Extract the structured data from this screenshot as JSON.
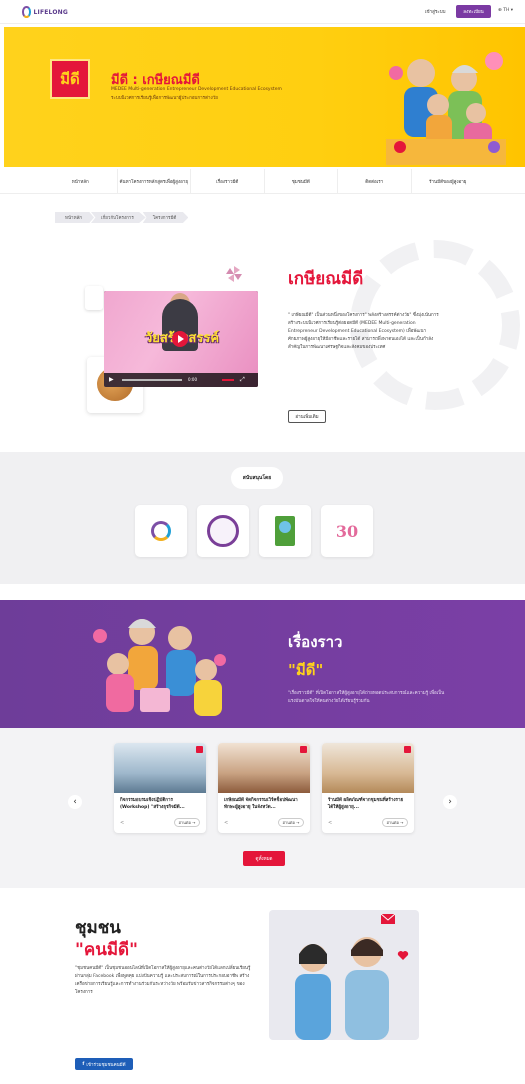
{
  "header": {
    "logo_text": "LIFELONG",
    "login_label": "เข้าสู่ระบบ",
    "register_label": "ลงทะเบียน",
    "lang_label": "TH"
  },
  "hero": {
    "logo_text": "มีดี",
    "title": "มีดี : เกษียณมีดี",
    "subtitle1": "MEDEE Multi-generation Entrepreneur Development Educational Ecosystem",
    "subtitle2": "ระบบนิเวศการเรียนรู้เพื่อการพัฒนาผู้ประกอบการต่างวัย",
    "colors": {
      "bg": "#ffd21c",
      "accent": "#e4163a"
    }
  },
  "nav": {
    "items": [
      "หน้าหลัก",
      "ค้นหาโครงการหลักสูตรเพื่อผู้สูงอายุ",
      "เรื่องราวมีดี",
      "ชุมชนมีดี",
      "ติดต่อเรา",
      "ร้านมีดีของผู้สูงอายุ"
    ]
  },
  "breadcrumb": [
    "หน้าหลัก",
    "เกี่ยวกับโครงการ",
    "โครงการมีดี"
  ],
  "about": {
    "title": "เกษียณมีดี",
    "video_caption": "วัยสร้างสรรค์",
    "video_time": "0:00",
    "text": "\" เกษียณมีดี\" เป็นส่วนหนึ่งของโครงการ\" พลังสร้างสรรค์ต่างวัย\" ซึ่งมุ่งเน้นการสร้างระบบนิเวศการเรียนรู้ต่อยอดมีดี (MEDEE Multi-generation Entrepreneur Development Educational Ecosystem) เพื่อพัฒนาศักยภาพผู้สูงอายุให้มีอาชีพและรายได้ สามารถพึ่งพาตนเองได้ และเป็นกำลังสำคัญในการพัฒนาเศรษฐกิจและสังคมของประเทศ",
    "button_label": "อ่านเพิ่มเติม"
  },
  "supporters": {
    "label": "สนับสนุนโดย",
    "logos": [
      "lifelong-logo",
      "university-seal",
      "green-badge",
      "thirty-years-logo"
    ]
  },
  "stories": {
    "title_line1": "เรื่องราว",
    "title_line2": "\"มีดี\"",
    "text": "\"เรื่องราวมีดี\" ที่เปิดโอกาสให้ผู้สูงอายุได้ถ่ายทอดประสบการณ์และความรู้ เพื่อเป็นแรงบันดาลใจให้คนต่างวัยได้เรียนรู้ร่วมกัน",
    "cards": [
      {
        "title": "กิจกรรมอบรมเชิงปฏิบัติการ (Workshop) \"สร้างธุรกิจมีดี...",
        "more": "อ่านต่อ"
      },
      {
        "title": "เกษียณมีดี จัดกิจกรรมเวิร์คช็อปพัฒนาทักษะผู้สูงอายุ ในจังหวัด...",
        "more": "อ่านต่อ"
      },
      {
        "title": "ร้านมีดี ผลิตภัณฑ์จากชุมชนที่สร้างรายได้ให้ผู้สูงอายุ...",
        "more": "อ่านต่อ"
      }
    ],
    "view_all_label": "ดูทั้งหมด"
  },
  "community": {
    "title_line1": "ชุมชน",
    "title_line2": "\"คนมีดี\"",
    "text": "\"ชุมชนคนมีดี\" เป็นชุมชนออนไลน์ที่เปิดโอกาสให้ผู้สูงอายุและคนต่างวัยได้แลกเปลี่ยนเรียนรู้ ผ่านกลุ่ม Facebook เพื่อพูดคุย แบ่งปันความรู้ และประสบการณ์ในการประกอบอาชีพ สร้างเครือข่ายการเรียนรู้และการทำงานร่วมกันระหว่างวัย พร้อมรับข่าวสารกิจกรรมต่างๆ ของโครงการ",
    "button_label": "เข้าร่วมชุมชนคนมีดี"
  }
}
